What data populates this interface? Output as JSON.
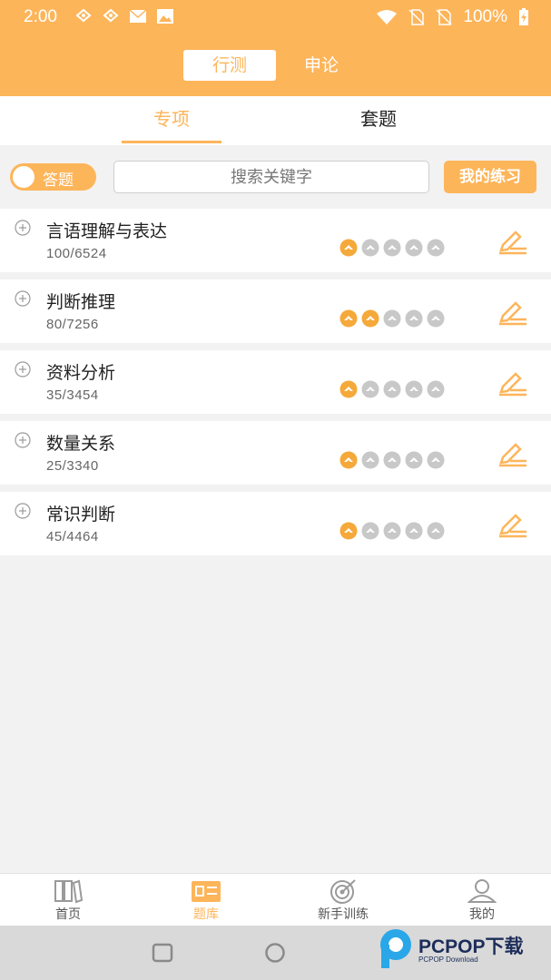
{
  "status_bar": {
    "time": "2:00",
    "battery": "100%",
    "left_icons": [
      "notification-icon",
      "notification-icon",
      "mail-icon",
      "image-icon"
    ],
    "right_icons": [
      "wifi-icon",
      "no-sim-icon",
      "no-sim-icon",
      "battery-charging-icon"
    ]
  },
  "header": {
    "segments": [
      {
        "label": "行测",
        "selected": true
      },
      {
        "label": "申论",
        "selected": false
      }
    ]
  },
  "subtabs": [
    {
      "label": "专项",
      "selected": true
    },
    {
      "label": "套题",
      "selected": false
    }
  ],
  "toolbar": {
    "toggle_label": "答题",
    "search_placeholder": "搜索关键字",
    "my_practice_label": "我的练习"
  },
  "categories": [
    {
      "title": "言语理解与表达",
      "progress": "100/6524",
      "level": 1,
      "max_level": 5
    },
    {
      "title": "判断推理",
      "progress": "80/7256",
      "level": 2,
      "max_level": 5
    },
    {
      "title": "资料分析",
      "progress": "35/3454",
      "level": 1,
      "max_level": 5
    },
    {
      "title": "数量关系",
      "progress": "25/3340",
      "level": 1,
      "max_level": 5
    },
    {
      "title": "常识判断",
      "progress": "45/4464",
      "level": 1,
      "max_level": 5
    }
  ],
  "bottom_nav": [
    {
      "label": "首页",
      "icon": "home-icon",
      "selected": false
    },
    {
      "label": "题库",
      "icon": "question-bank-icon",
      "selected": true
    },
    {
      "label": "新手训练",
      "icon": "target-icon",
      "selected": false
    },
    {
      "label": "我的",
      "icon": "profile-icon",
      "selected": false
    }
  ],
  "watermark": {
    "brand": "PCPOP下载",
    "sub": "PCPOP Download"
  },
  "colors": {
    "accent": "#fdb55a",
    "star_active": "#f5a93a",
    "star_inactive": "#c8c8c8",
    "background": "#f2f2f2"
  }
}
